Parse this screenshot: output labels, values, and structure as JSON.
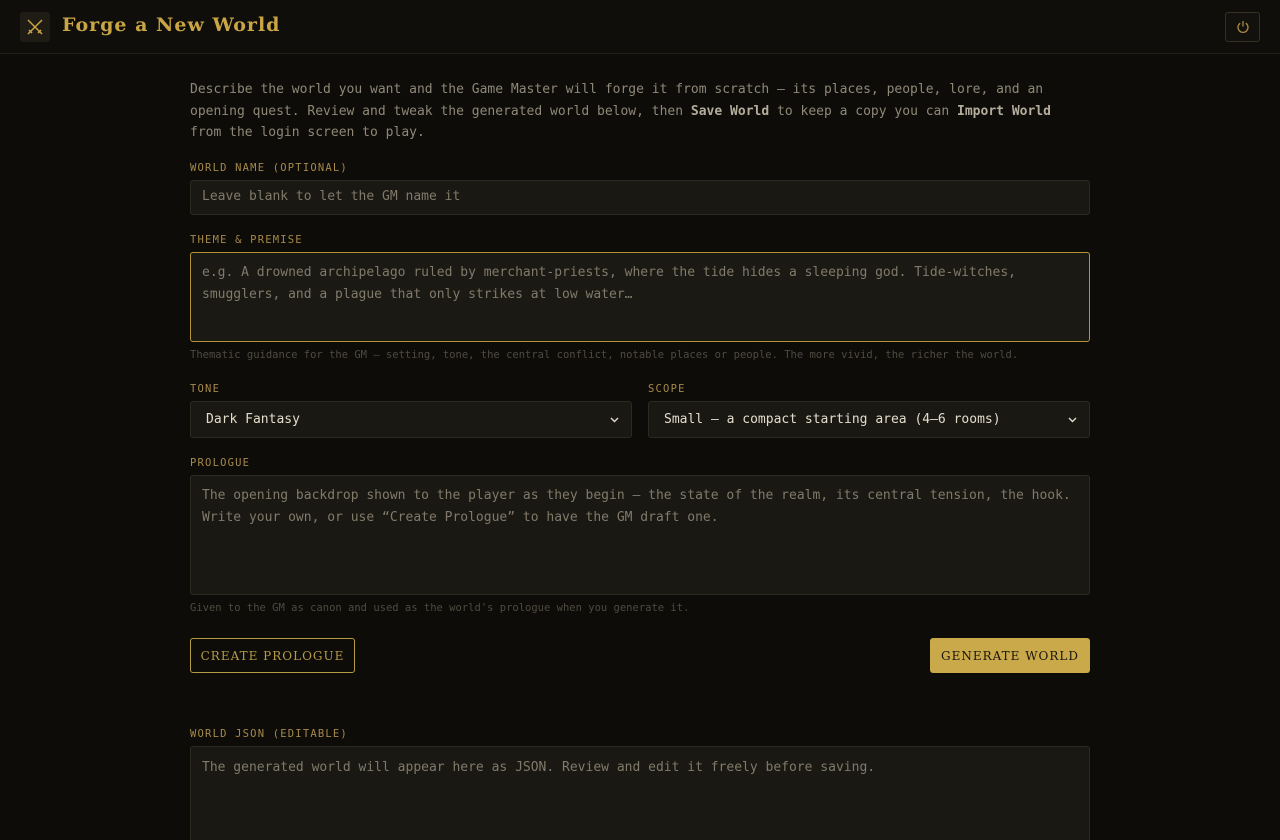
{
  "header": {
    "title": "Forge a New World",
    "logo_icon": "crossed-swords-icon",
    "power_icon": "power-icon"
  },
  "intro": {
    "part1": "Describe the world you want and the Game Master will forge it from scratch — its places, people, lore, and an opening quest. Review and tweak the generated world below, then ",
    "save_world": "Save World",
    "part2": " to keep a copy you can ",
    "import_world": "Import World",
    "part3": " from the login screen to play."
  },
  "world_name": {
    "label": "World Name (optional)",
    "placeholder": "Leave blank to let the GM name it",
    "value": ""
  },
  "theme": {
    "label": "Theme & Premise",
    "placeholder": "e.g. A drowned archipelago ruled by merchant-priests, where the tide hides a sleeping god. Tide-witches, smugglers, and a plague that only strikes at low water…",
    "hint": "Thematic guidance for the GM — setting, tone, the central conflict, notable places or people. The more vivid, the richer the world."
  },
  "tone": {
    "label": "Tone",
    "selected": "Dark Fantasy"
  },
  "scope": {
    "label": "Scope",
    "selected": "Small — a compact starting area (4–6 rooms)"
  },
  "prologue": {
    "label": "Prologue",
    "placeholder": "The opening backdrop shown to the player as they begin — the state of the realm, its central tension, the hook. Write your own, or use “Create Prologue” to have the GM draft one.",
    "hint": "Given to the GM as canon and used as the world's prologue when you generate it."
  },
  "actions": {
    "create_prologue": "CREATE PROLOGUE",
    "generate_world": "GENERATE WORLD"
  },
  "world_json": {
    "label": "World JSON (editable)",
    "placeholder": "The generated world will appear here as JSON. Review and edit it freely before saving."
  },
  "colors": {
    "accent": "#c9a94a",
    "background": "#0d0c09",
    "field": "#1a1813"
  }
}
